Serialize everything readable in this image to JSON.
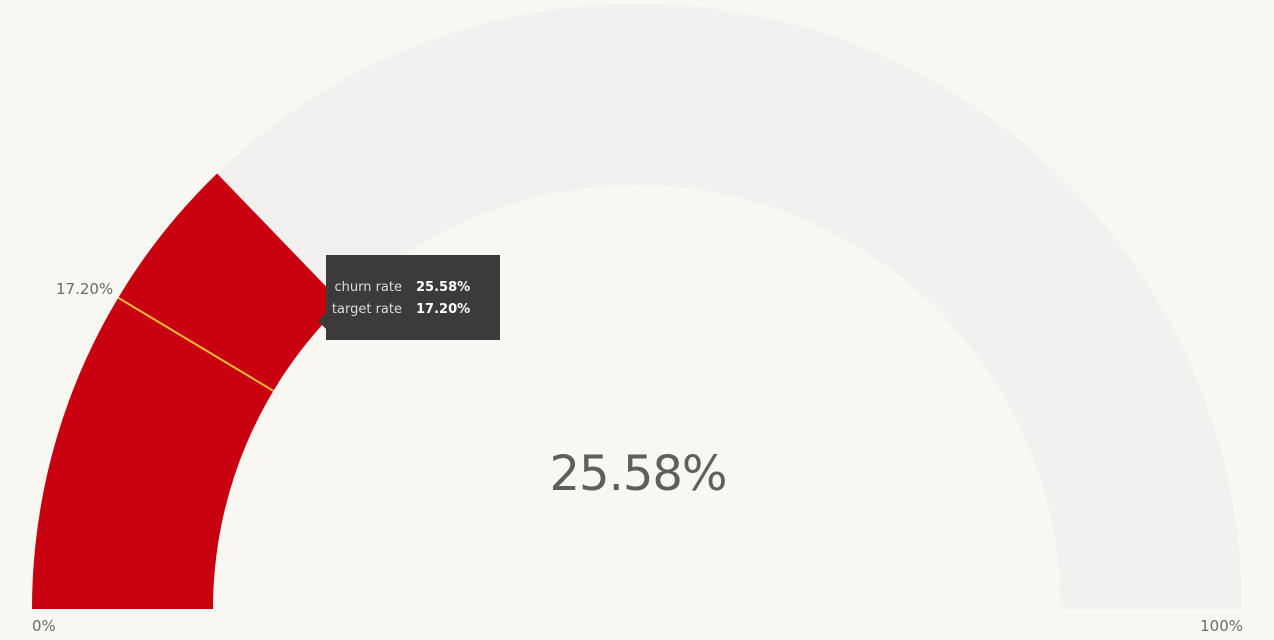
{
  "chart_data": {
    "type": "gauge",
    "min": 0,
    "max": 100,
    "value": 25.58,
    "target": 17.2,
    "min_label": "0%",
    "max_label": "100%",
    "value_label": "25.58%",
    "target_label": "17.20%",
    "colors": {
      "fill": "#c8000f",
      "track": "#f2f1ef",
      "target_line": "#e6b83a",
      "background": "#f8f7f2"
    }
  },
  "tooltip": {
    "rows": [
      {
        "label": "churn rate",
        "value": "25.58%"
      },
      {
        "label": "target rate",
        "value": "17.20%"
      }
    ]
  }
}
